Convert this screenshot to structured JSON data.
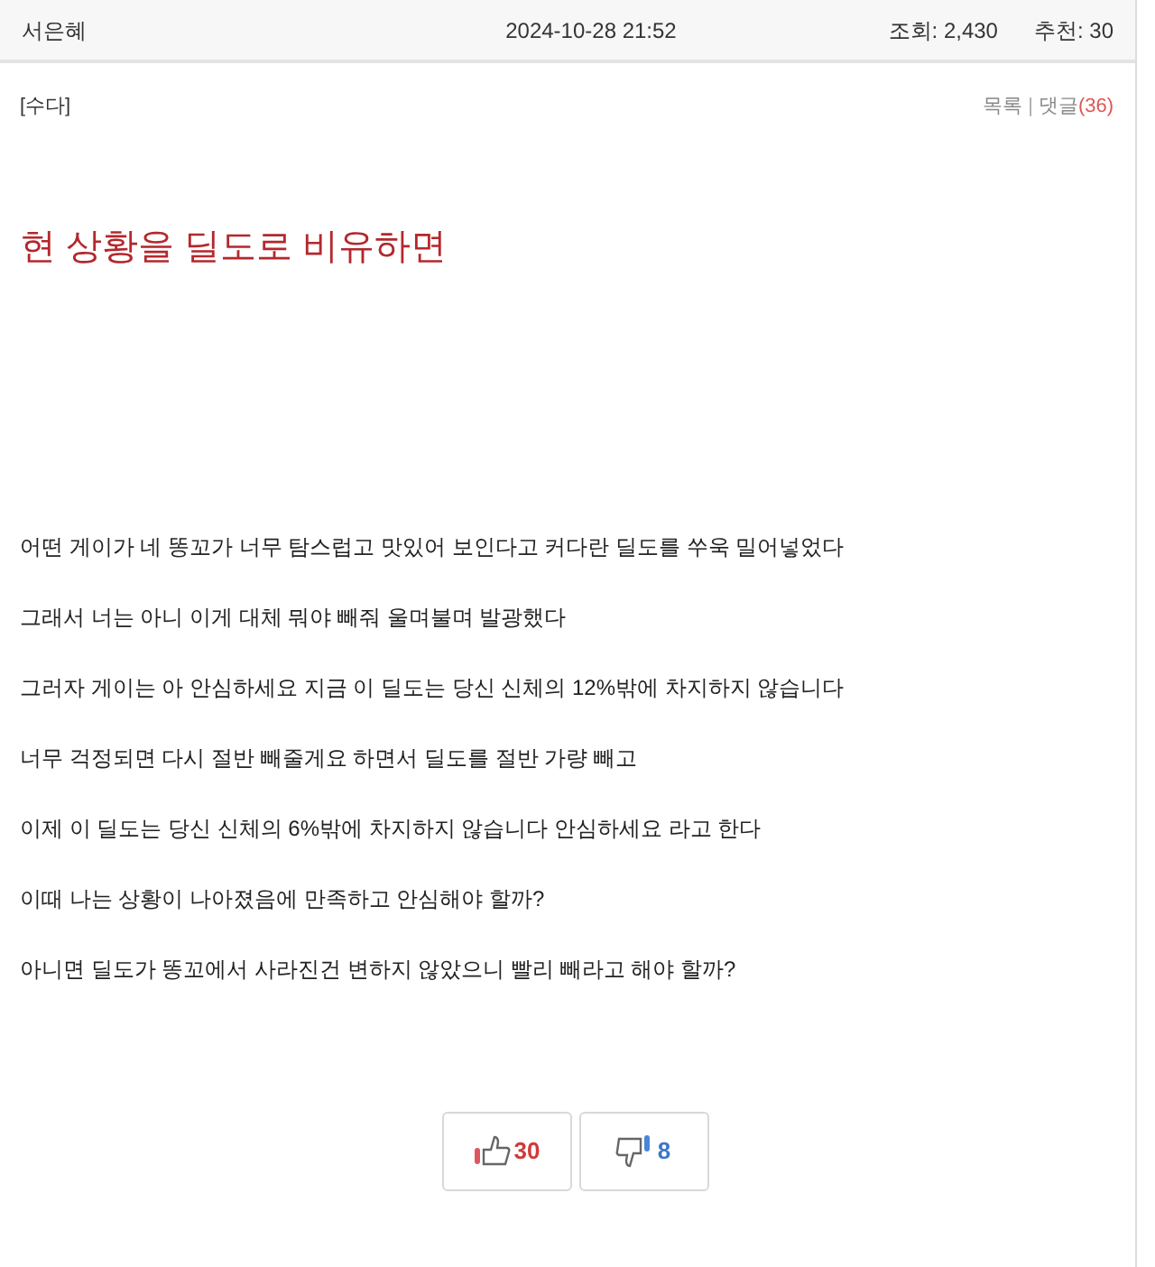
{
  "post_header": {
    "author": "서은혜",
    "date": "2024-10-28 21:52",
    "views": "조회: 2,430",
    "recommends": "추천: 30"
  },
  "category": "[수다]",
  "nav": {
    "list_link": "목록",
    "separator": "|",
    "comments_link": "댓글",
    "comment_count": "(36)"
  },
  "title": "현 상황을 딜도로 비유하면",
  "paragraphs": [
    "어떤 게이가 네 똥꼬가 너무 탐스럽고 맛있어 보인다고 커다란 딜도를 쑤욱 밀어넣었다",
    "그래서 너는 아니 이게 대체 뭐야 빼줘 울며불며 발광했다",
    "그러자 게이는 아 안심하세요 지금 이 딜도는 당신 신체의 12%밖에 차지하지 않습니다",
    "너무 걱정되면 다시 절반 빼줄게요 하면서 딜도를 절반 가량 빼고",
    "이제 이 딜도는 당신 신체의 6%밖에 차지하지 않습니다 안심하세요 라고 한다",
    "이때 나는 상황이 나아졌음에 만족하고 안심해야 할까?",
    "아니면 딜도가 똥꼬에서 사라진건 변하지 않았으니 빨리 빼라고 해야 할까?"
  ],
  "votes": [
    {
      "kind": "up",
      "count": "30"
    },
    {
      "kind": "down",
      "count": "8"
    }
  ]
}
